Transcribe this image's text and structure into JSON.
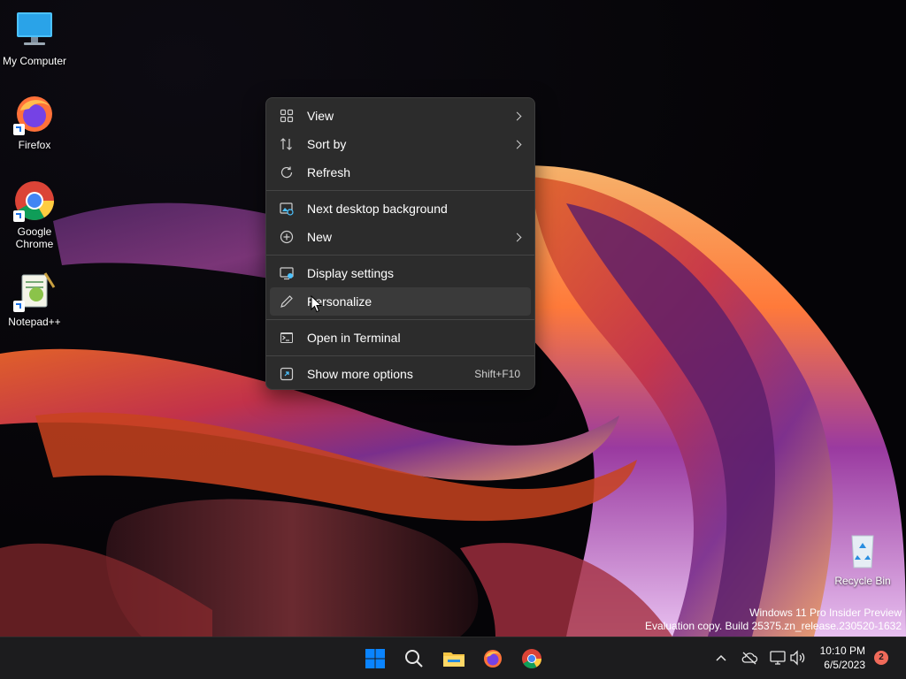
{
  "desktop": {
    "icons": [
      {
        "label": "My Computer"
      },
      {
        "label": "Firefox"
      },
      {
        "label": "Google Chrome"
      },
      {
        "label": "Notepad++"
      },
      {
        "label": "Recycle Bin"
      }
    ]
  },
  "context_menu": {
    "items": {
      "view": {
        "label": "View"
      },
      "sort_by": {
        "label": "Sort by"
      },
      "refresh": {
        "label": "Refresh"
      },
      "next_bg": {
        "label": "Next desktop background"
      },
      "new": {
        "label": "New"
      },
      "display": {
        "label": "Display settings"
      },
      "personalize": {
        "label": "Personalize"
      },
      "terminal": {
        "label": "Open in Terminal"
      },
      "more": {
        "label": "Show more options",
        "shortcut": "Shift+F10"
      }
    }
  },
  "watermark": {
    "line1": "Windows 11 Pro Insider Preview",
    "line2": "Evaluation copy. Build 25375.zn_release.230520-1632"
  },
  "taskbar": {
    "time": "10:10 PM",
    "date": "6/5/2023",
    "notification_count": "2"
  },
  "colors": {
    "menu_bg": "#2c2c2c",
    "menu_highlight": "#3a3a3a",
    "taskbar_bg": "#1c1c1e",
    "windows_blue": "#0a84ff",
    "notification_badge": "#f06a5a"
  }
}
